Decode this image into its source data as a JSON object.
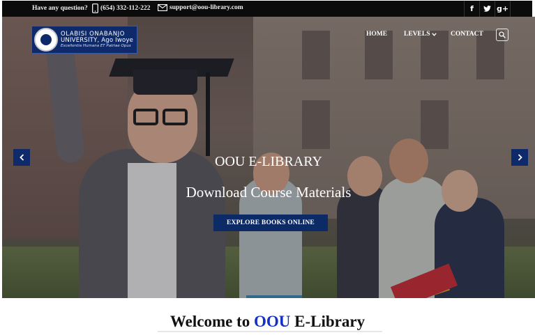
{
  "topbar": {
    "question": "Have any question?",
    "phone": "(654) 332-112-222",
    "email": "support@oou-library.com",
    "social": [
      {
        "name": "facebook-icon",
        "glyph": "f"
      },
      {
        "name": "twitter-icon",
        "glyph": "t"
      },
      {
        "name": "google-plus-icon",
        "glyph": "g+"
      }
    ]
  },
  "logo": {
    "line1": "OLABISI ONABANJO",
    "line2": "UNIVERSITY, Ago Iwoye",
    "line3": "Excellentia Humana ET Patriae Opus"
  },
  "nav": {
    "home": "HOME",
    "levels": "LEVELS",
    "contact": "CONTACT"
  },
  "hero": {
    "title": "OOU E-LIBRARY",
    "subtitle": "Download Course Materials",
    "button": "EXPLORE BOOKS ONLINE"
  },
  "welcome": {
    "prefix": "Welcome to ",
    "accent": "OOU",
    "suffix": " E-Library"
  },
  "colors": {
    "brand": "#0e2a6b",
    "accent": "#1530c4",
    "topbar": "#0b0b0b"
  }
}
